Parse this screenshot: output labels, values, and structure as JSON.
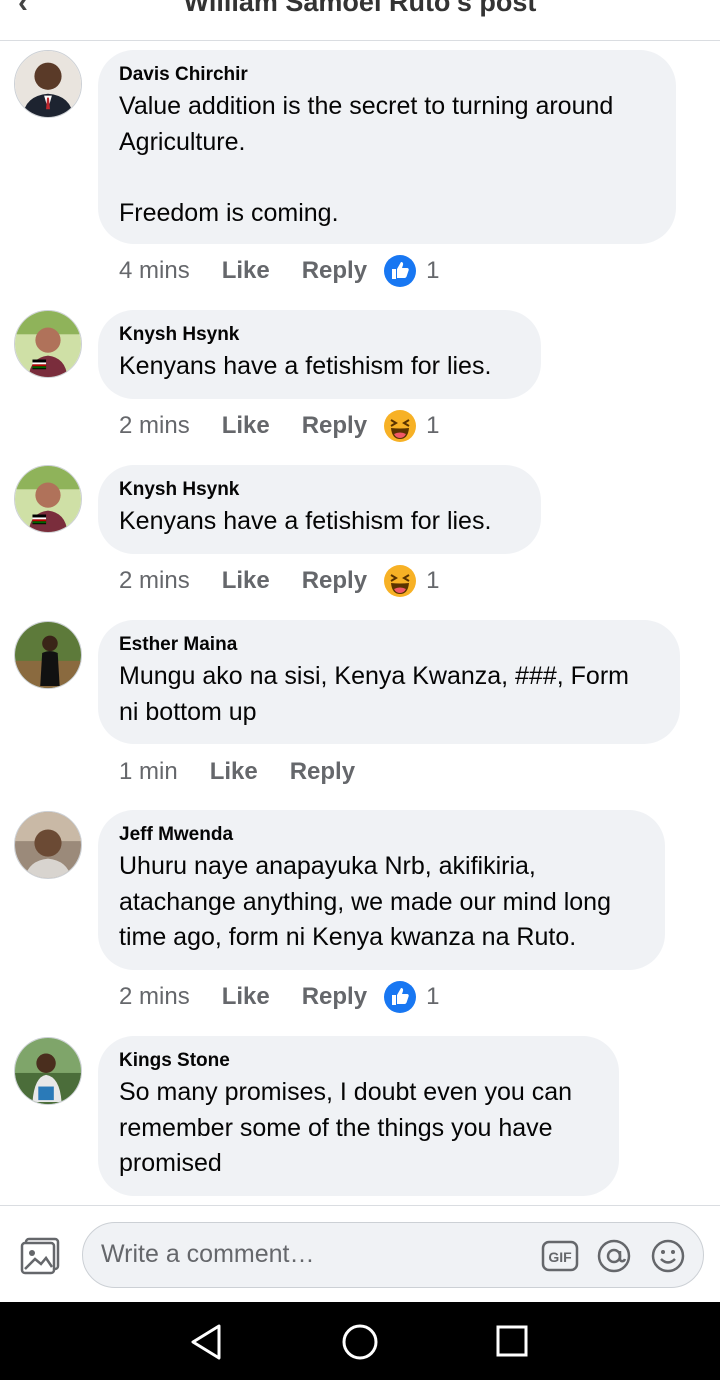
{
  "header": {
    "title": "William Samoei Ruto's post"
  },
  "comments": [
    {
      "author": "Davis Chirchir",
      "text": "Value addition is the secret to turning around\nAgriculture.\n\nFreedom is coming.",
      "time": "4 mins",
      "like": "Like",
      "reply": "Reply",
      "reaction": "like-reaction-icon",
      "reaction_count": "1"
    },
    {
      "author": "Knysh Hsynk",
      "text": "Kenyans have a fetishism for lies.",
      "time": "2 mins",
      "like": "Like",
      "reply": "Reply",
      "reaction": "haha-reaction-icon",
      "reaction_count": "1"
    },
    {
      "author": "Knysh Hsynk",
      "text": "Kenyans have a fetishism for lies.",
      "time": "2 mins",
      "like": "Like",
      "reply": "Reply",
      "reaction": "haha-reaction-icon",
      "reaction_count": "1"
    },
    {
      "author": "Esther Maina",
      "text": "Mungu ako na sisi, Kenya Kwanza, ###, Form\nni bottom up",
      "time": "1 min",
      "like": "Like",
      "reply": "Reply"
    },
    {
      "author": "Jeff Mwenda",
      "text": "Uhuru naye anapayuka Nrb, akifikiria,\natachange anything, we made our mind long\ntime ago, form ni Kenya kwanza na Ruto.",
      "time": "2 mins",
      "like": "Like",
      "reply": "Reply",
      "reaction": "like-reaction-icon",
      "reaction_count": "1"
    },
    {
      "author": "Kings Stone",
      "text": "So many promises, I doubt even you can\nremember some of the things you have\npromised"
    }
  ],
  "composer": {
    "placeholder": "Write a comment…",
    "icons": [
      "photo-icon",
      "gif-icon",
      "at-icon",
      "emoji-icon"
    ]
  },
  "navbar": {
    "icons": [
      "nav-back-icon",
      "nav-home-icon",
      "nav-recents-icon"
    ]
  },
  "colors": {
    "like_blue": "#1877f2",
    "haha_yellow": "#f7b125",
    "bubble_bg": "#f0f2f5",
    "meta_gray": "#65676b"
  }
}
